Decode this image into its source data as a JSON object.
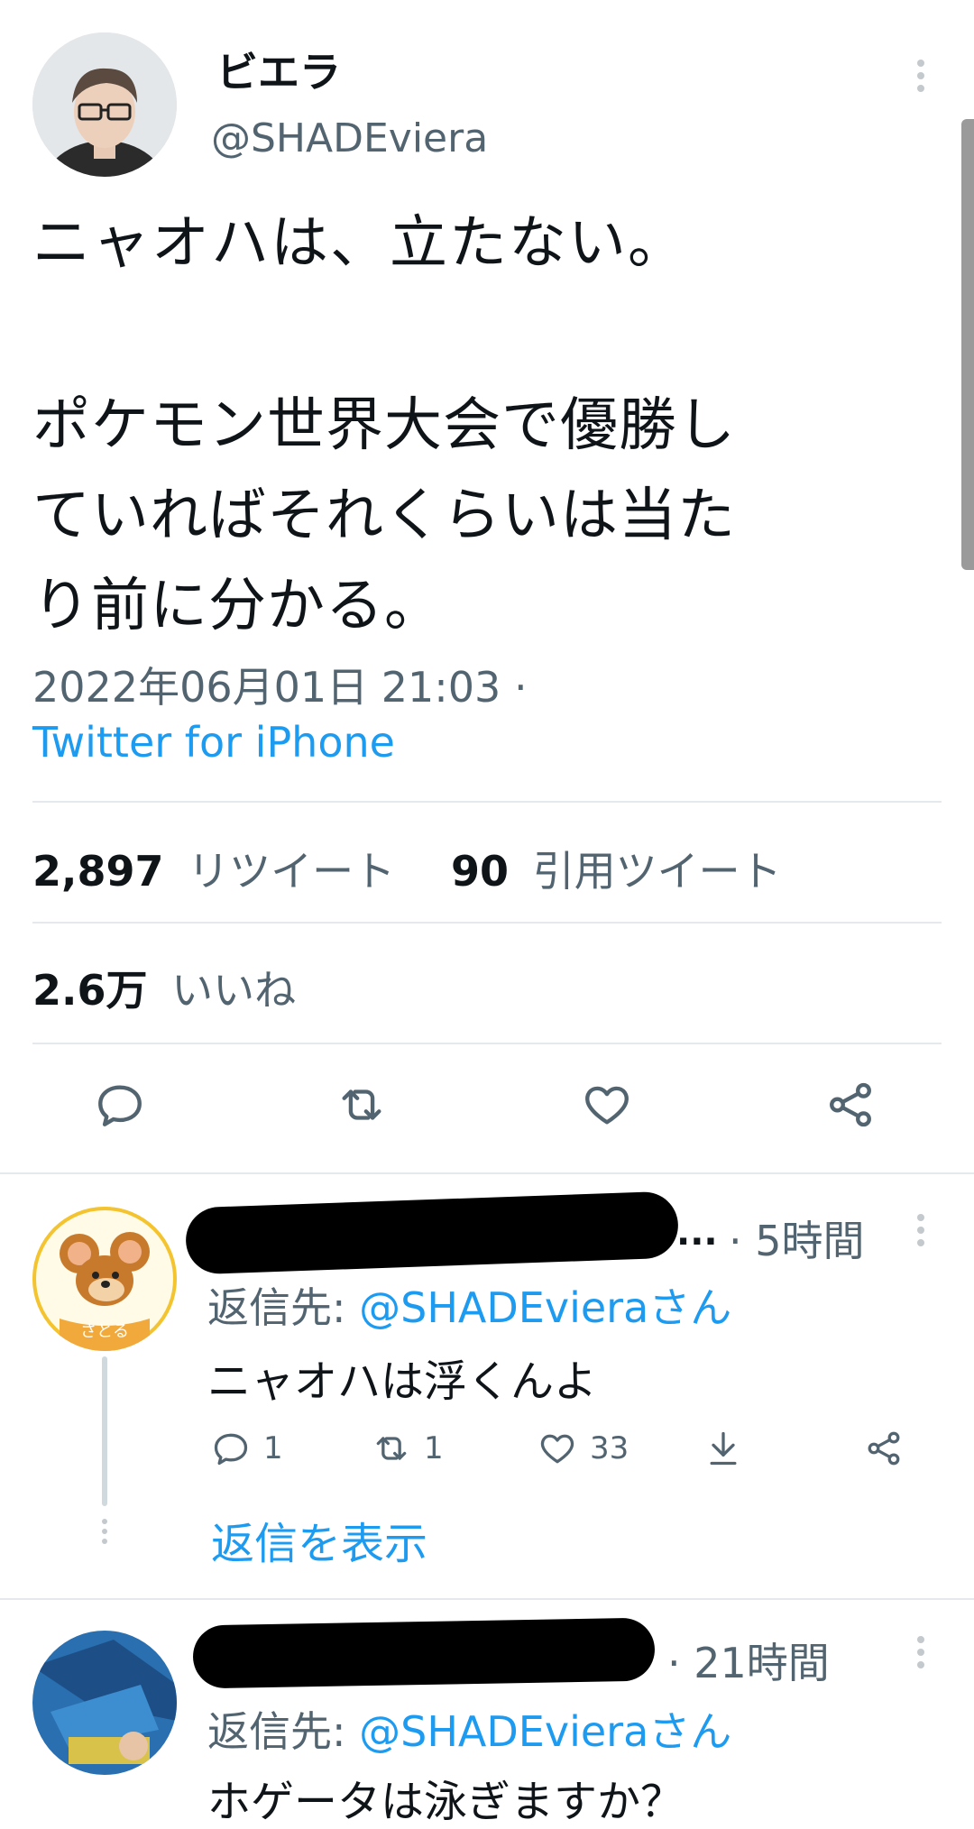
{
  "tweet": {
    "display_name": "ビエラ",
    "handle": "@SHADEviera",
    "text_line1": "ニャオハは、立たない。",
    "text_line2": "ポケモン世界大会で優勝し",
    "text_line3": "ていればそれくらいは当た",
    "text_line4": "り前に分かる。",
    "timestamp": "2022年06月01日 21:03 ·",
    "source": "Twitter for iPhone",
    "retweets_count": "2,897",
    "retweets_label": "リツイート",
    "quotes_count": "90",
    "quotes_label": "引用ツイート",
    "likes_count": "2.6万",
    "likes_label": "いいね"
  },
  "replies": [
    {
      "name_ellipsis": "...",
      "time": "· 5時間",
      "reply_to_prefix": "返信先: ",
      "reply_to_handle": "@SHADEvieraさん",
      "text": "ニャオハは浮くんよ",
      "reply_count": "1",
      "retweet_count": "1",
      "like_count": "33",
      "show_replies": "返信を表示",
      "avatar_caption": "さとる"
    },
    {
      "time": "· 21時間",
      "reply_to_prefix": "返信先: ",
      "reply_to_handle": "@SHADEvieraさん",
      "text": "ホゲータは泳ぎますか？"
    }
  ],
  "icons": [
    "more-icon",
    "reply-icon",
    "retweet-icon",
    "like-icon",
    "share-icon",
    "download-icon"
  ],
  "colors": {
    "link": "#1d9bf0",
    "text": "#0f1419",
    "muted": "#536471",
    "divider": "#e6e9ec"
  }
}
